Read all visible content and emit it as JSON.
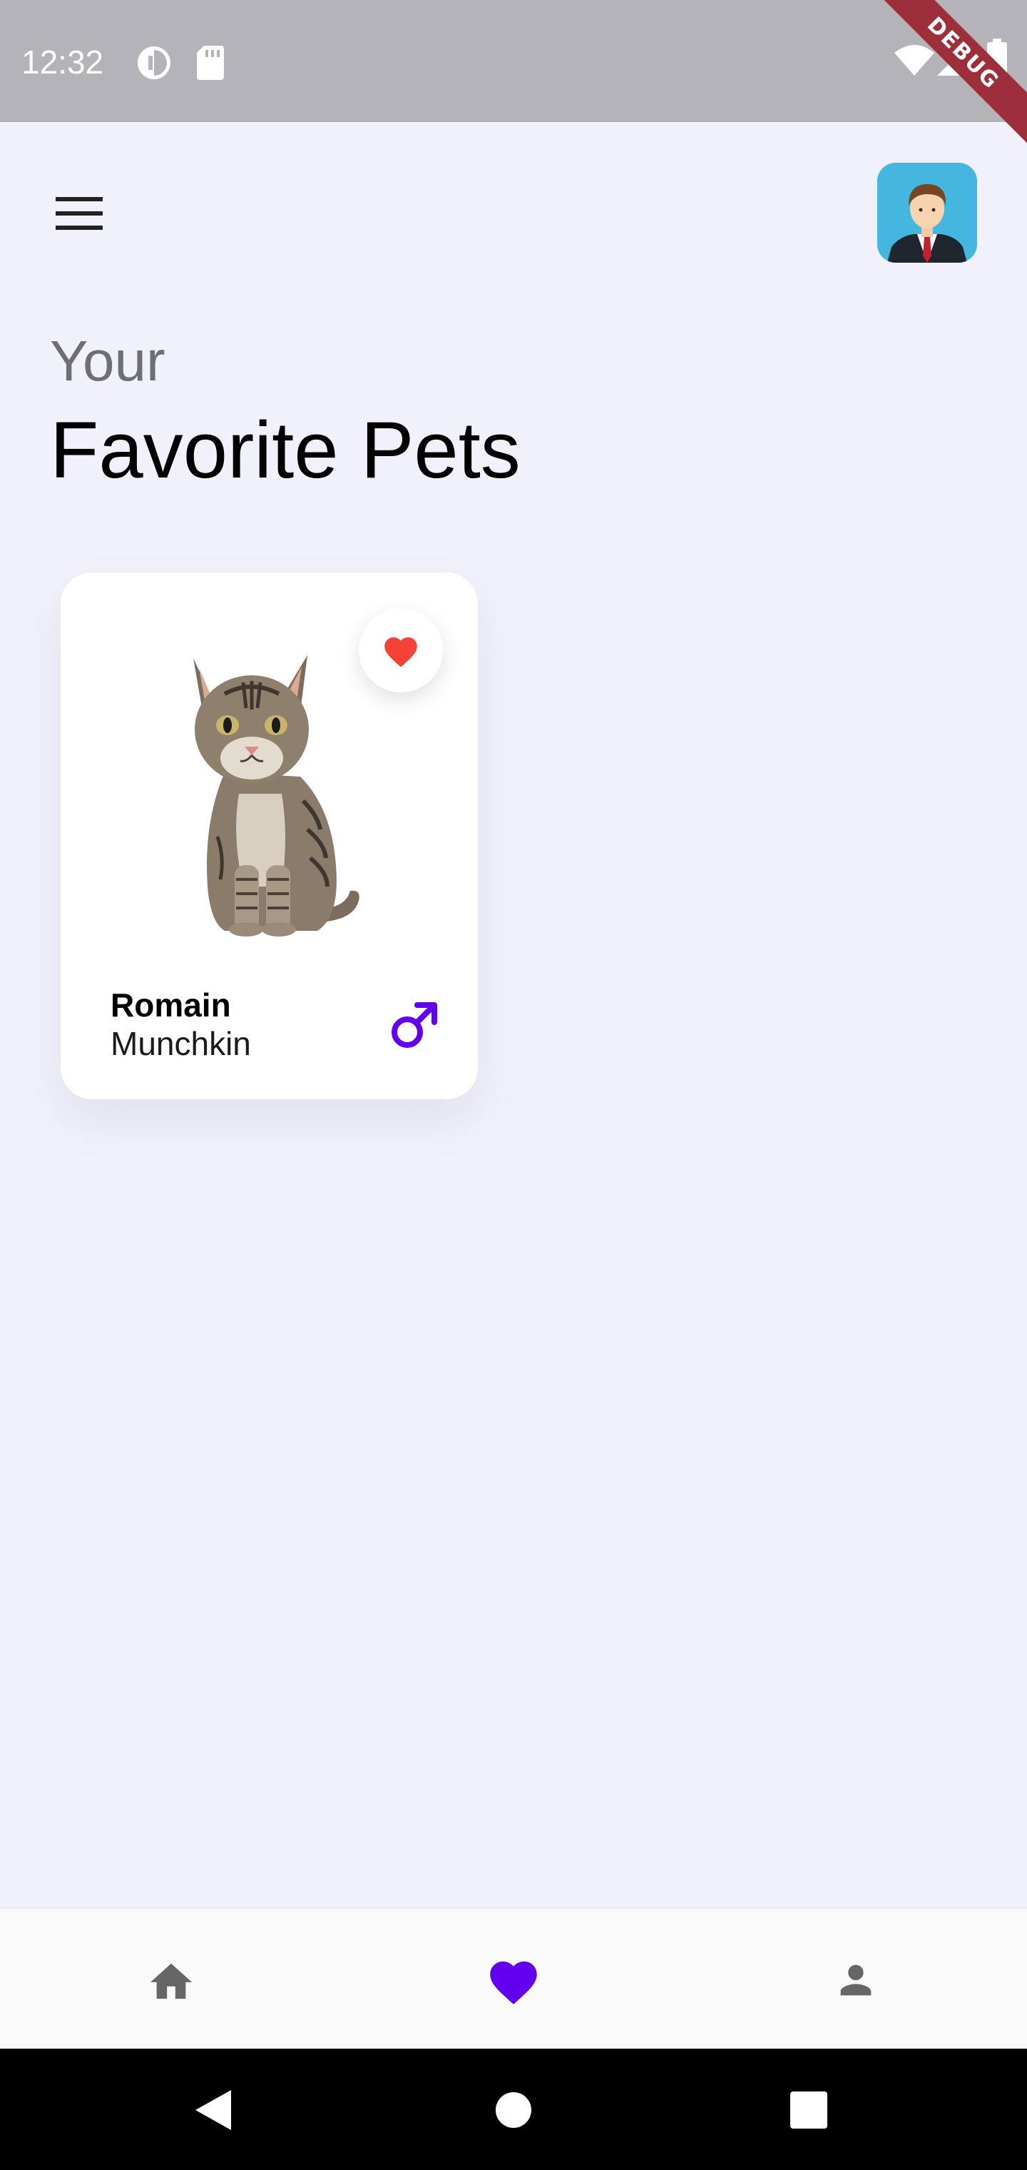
{
  "status_bar": {
    "time": "12:32",
    "icons": [
      "data-saver-icon",
      "sd-card-icon",
      "wifi-icon",
      "signal-icon",
      "battery-icon"
    ]
  },
  "debug_banner": {
    "label": "DEBUG"
  },
  "header": {
    "menu_icon": "menu-icon",
    "avatar_icon": "businessman-avatar"
  },
  "page": {
    "greeting": "Your",
    "title": "Favorite Pets"
  },
  "pets": [
    {
      "name": "Romain",
      "breed": "Munchkin",
      "image": "tabby-cat",
      "favorite": true,
      "gender_icon": "male-icon"
    }
  ],
  "bottom_nav": {
    "items": [
      {
        "icon": "home-icon",
        "active": false
      },
      {
        "icon": "heart-icon",
        "active": true
      },
      {
        "icon": "person-icon",
        "active": false
      }
    ]
  },
  "system_nav": [
    "back-icon",
    "home-circle-icon",
    "recents-square-icon"
  ],
  "colors": {
    "accent": "#6200ee",
    "favorite": "#f44336",
    "background": "#f1f1fb",
    "status_bar": "#b3b3b8",
    "inactive_icon": "#666666",
    "avatar_bg": "#45b6e0"
  }
}
